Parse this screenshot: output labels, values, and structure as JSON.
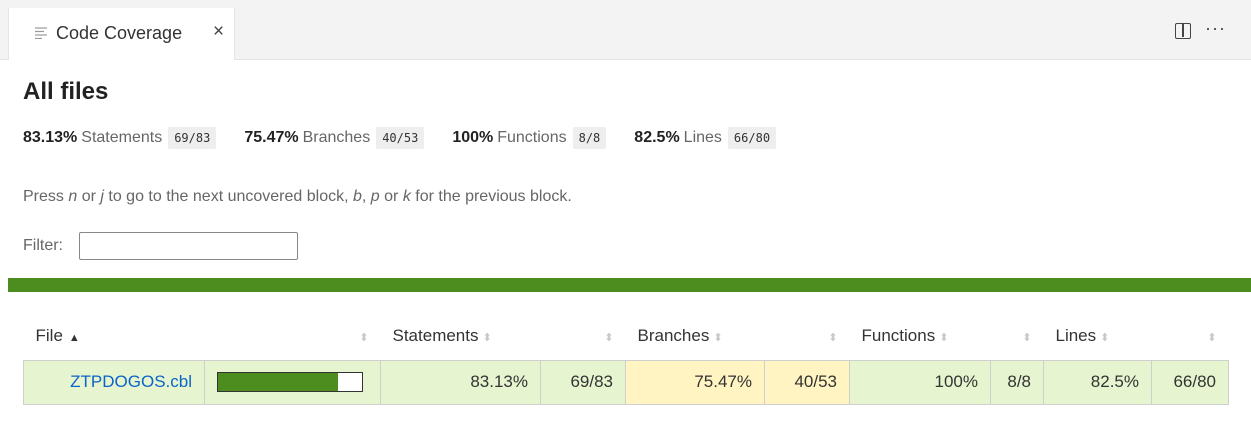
{
  "tab": {
    "icon": "preview-icon",
    "label": "Code Coverage",
    "close_glyph": "×"
  },
  "editor_actions": {
    "split": "split-editor-icon",
    "more_glyph": "···"
  },
  "page": {
    "title": "All files",
    "stats": [
      {
        "pct": "83.13%",
        "label": "Statements",
        "frac": "69/83"
      },
      {
        "pct": "75.47%",
        "label": "Branches",
        "frac": "40/53"
      },
      {
        "pct": "100%",
        "label": "Functions",
        "frac": "8/8"
      },
      {
        "pct": "82.5%",
        "label": "Lines",
        "frac": "66/80"
      }
    ],
    "hint": {
      "t1": "Press ",
      "k1": "n",
      "t2": " or ",
      "k2": "j",
      "t3": " to go to the next uncovered block, ",
      "k3": "b",
      "t4": ", ",
      "k4": "p",
      "t5": " or ",
      "k5": "k",
      "t6": " for the previous block."
    },
    "filter_label": "Filter:",
    "filter_value": ""
  },
  "colors": {
    "coverage_high": "#4d8c1f",
    "cell_high": "#e6f5d0",
    "cell_medium": "#fff4c2",
    "link": "#0b64c7"
  },
  "table": {
    "headers": {
      "file": "File",
      "statements": "Statements",
      "branches": "Branches",
      "functions": "Functions",
      "lines": "Lines"
    },
    "rows": [
      {
        "file": "ZTPDOGOS.cbl",
        "coverage_fraction": 0.8313,
        "statements_pct": "83.13%",
        "statements_frac": "69/83",
        "branches_pct": "75.47%",
        "branches_frac": "40/53",
        "functions_pct": "100%",
        "functions_frac": "8/8",
        "lines_pct": "82.5%",
        "lines_frac": "66/80"
      }
    ]
  }
}
